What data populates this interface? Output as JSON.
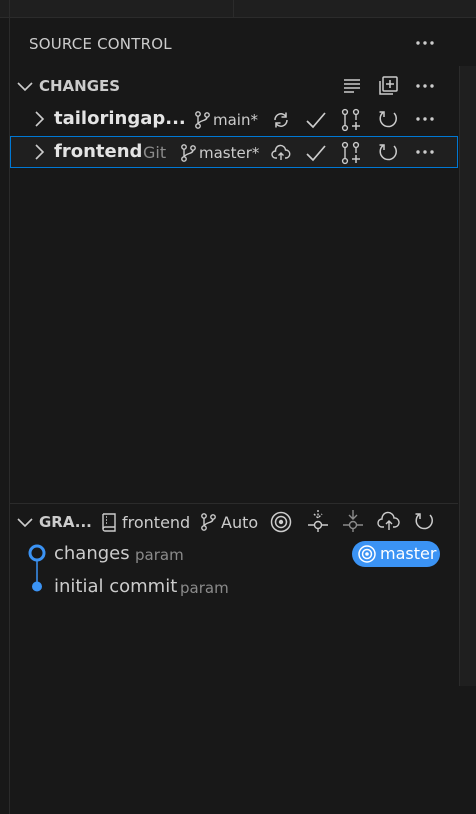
{
  "header": {
    "title": "SOURCE CONTROL",
    "more_icon": "ellipsis-icon"
  },
  "changes_section": {
    "label": "CHANGES",
    "icons": [
      "list-flat-icon",
      "add-repository-icon",
      "ellipsis-icon"
    ]
  },
  "repositories": [
    {
      "name": "tailoringap...",
      "type": "",
      "branch": "main*",
      "selected": false,
      "actions": [
        "sync-icon",
        "commit-check-icon",
        "pull-request-icon",
        "refresh-icon",
        "ellipsis-icon"
      ]
    },
    {
      "name": "frontend",
      "type": "Git",
      "branch": "master*",
      "selected": true,
      "actions": [
        "publish-cloud-icon",
        "commit-check-icon",
        "pull-request-icon",
        "refresh-icon",
        "ellipsis-icon"
      ]
    }
  ],
  "graph_section": {
    "label": "GRA...",
    "repo": "frontend",
    "branch_mode": "Auto",
    "icons": [
      "target-icon",
      "fetch-icon",
      "pull-icon",
      "push-cloud-icon",
      "refresh-icon"
    ]
  },
  "commits": [
    {
      "message": "changes",
      "author": "param",
      "ref_badge": "master",
      "node": "hollow"
    },
    {
      "message": "initial commit",
      "author": "param",
      "node": "filled"
    }
  ],
  "colors": {
    "background": "#181818",
    "accent": "#0078d4",
    "graph_blue": "#3b93f4",
    "text": "#cccccc",
    "muted": "#8b8b8b"
  }
}
